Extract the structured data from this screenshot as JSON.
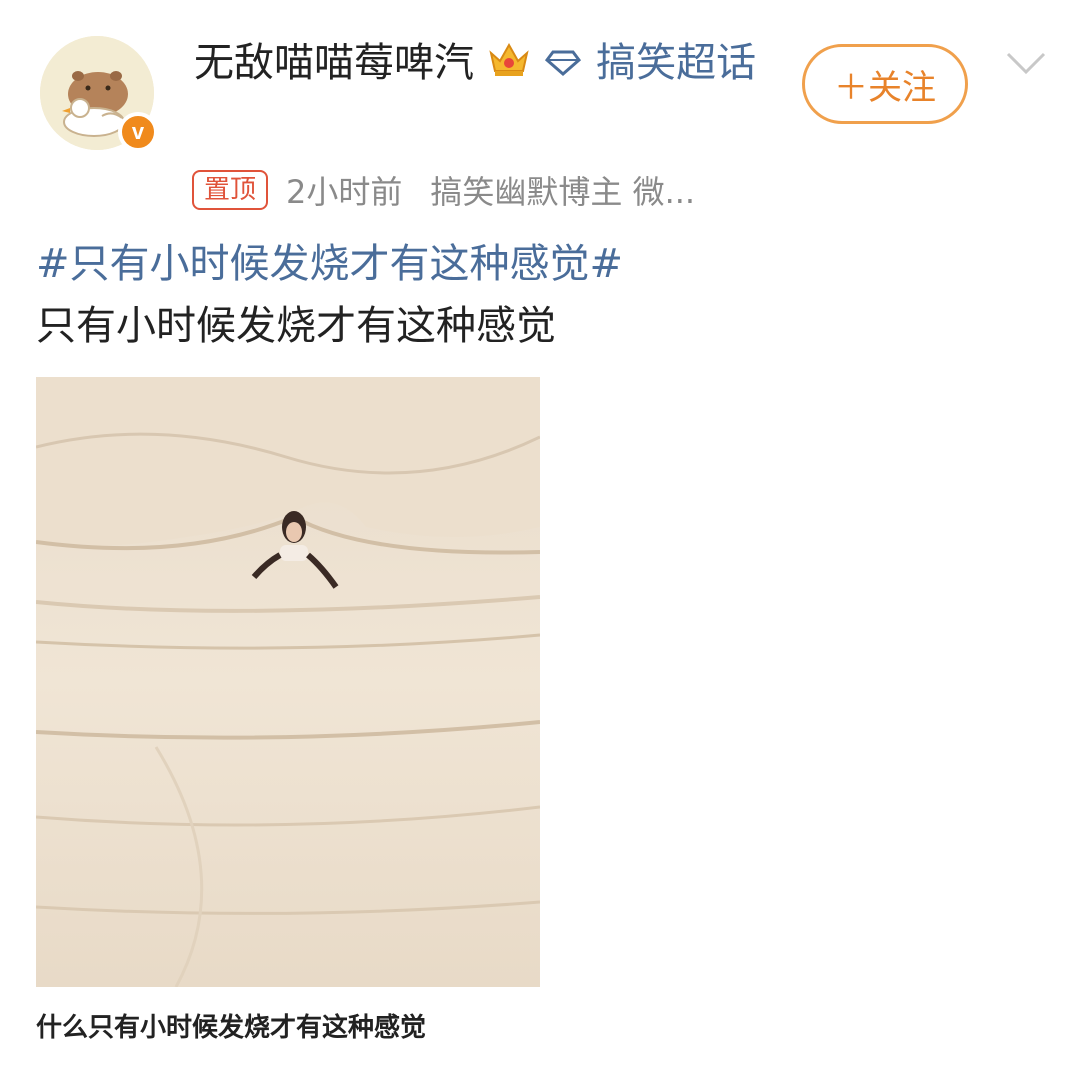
{
  "user": {
    "name": "无敌喵喵莓啤汽",
    "verified_mark": "v",
    "topic": "搞笑超话"
  },
  "follow_button": {
    "label": "＋关注"
  },
  "meta": {
    "pinned": "置顶",
    "time": "2小时前",
    "source": "搞笑幽默博主 微..."
  },
  "post": {
    "hashtag": "#只有小时候发烧才有这种感觉#",
    "text": "只有小时候发烧才有这种感觉",
    "image_caption": "什么只有小时候发烧才有这种感觉"
  },
  "icons": [
    "crown-icon",
    "diamond-icon",
    "chevron-down-icon"
  ],
  "colors": {
    "accent": "#e8832a",
    "link": "#4a6d9a",
    "pinned": "#e0533a"
  }
}
